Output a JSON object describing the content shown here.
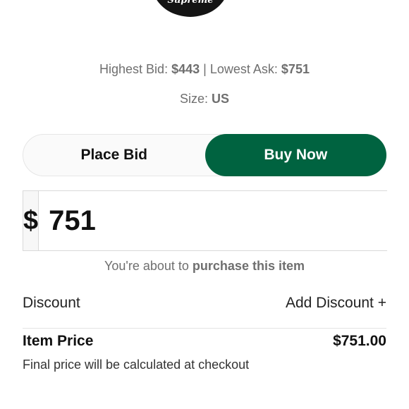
{
  "product": {
    "brand_text": "Supreme",
    "image_color": "#141414"
  },
  "pricing": {
    "highest_bid_label": "Highest Bid:",
    "highest_bid_value": "$443",
    "separator": "|",
    "lowest_ask_label": "Lowest Ask:",
    "lowest_ask_value": "$751"
  },
  "size": {
    "label": "Size:",
    "value": "US"
  },
  "toggle": {
    "place_bid_label": "Place Bid",
    "buy_now_label": "Buy Now",
    "active": "buy_now",
    "active_color": "#006340"
  },
  "amount": {
    "currency_symbol": "$",
    "value": "751"
  },
  "notice": {
    "prefix": "You're about to",
    "action": "purchase this item"
  },
  "discount": {
    "label": "Discount",
    "add_label": "Add Discount +"
  },
  "item_price": {
    "label": "Item Price",
    "value": "$751.00"
  },
  "checkout_note": "Final price will be calculated at checkout"
}
